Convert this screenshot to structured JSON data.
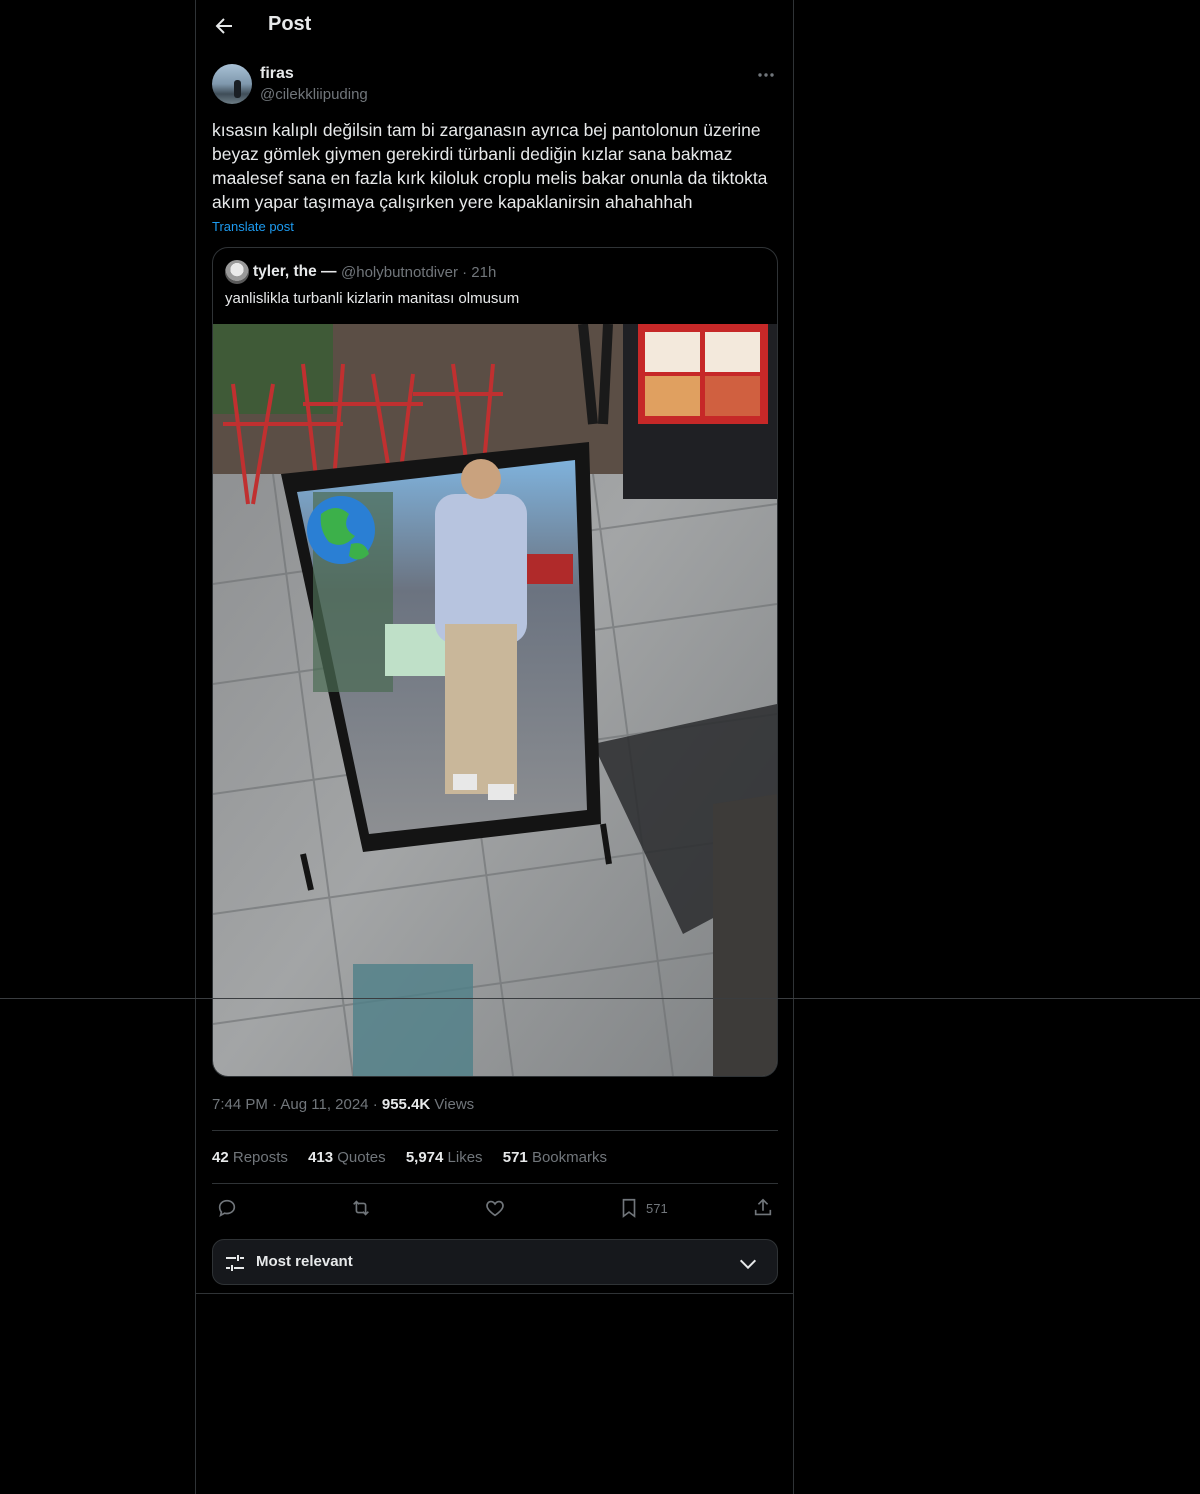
{
  "header": {
    "title": "Post"
  },
  "post": {
    "author_name": "firas",
    "author_handle": "@cilekkliipuding",
    "text": "kısasın kalıplı değilsin tam bi zarganasın ayrıca bej pantolonun üzerine beyaz gömlek giymen gerekirdi türbanli dediğin kızlar sana bakmaz maalesef sana en fazla kırk kiloluk croplu melis bakar onunla da tiktokta akım yapar taşımaya çalışırken yere kapaklanirsin ahahahhah",
    "translate_label": "Translate post"
  },
  "quote": {
    "author_name": "tyler, the —",
    "author_handle": "@holybutnotdiver",
    "time": "· 21h",
    "text": "yanlislikla turbanli kizlarin manitası olmusum"
  },
  "meta": {
    "time": "7:44 PM",
    "dot1": "·",
    "date": "Aug 11, 2024",
    "dot2": "·",
    "views_count": "955.4K",
    "views_label": "Views"
  },
  "stats": {
    "reposts_count": "42",
    "reposts_label": "Reposts",
    "quotes_count": "413",
    "quotes_label": "Quotes",
    "likes_count": "5,974",
    "likes_label": "Likes",
    "bookmarks_count": "571",
    "bookmarks_label": "Bookmarks"
  },
  "actions": {
    "bookmark_count": "571"
  },
  "sort": {
    "label": "Most relevant"
  },
  "icons": [
    "back-arrow-icon",
    "more-icon",
    "reply-icon",
    "repost-icon",
    "like-icon",
    "bookmark-icon",
    "share-icon",
    "filter-icon",
    "chevron-down-icon"
  ],
  "colors": {
    "background": "#000000",
    "text": "#e7e9ea",
    "muted": "#71767b",
    "link": "#1d9bf0",
    "border": "#2f3336"
  }
}
